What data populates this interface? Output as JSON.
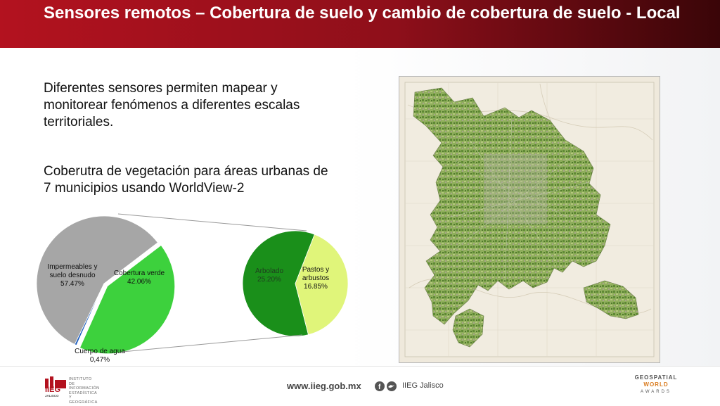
{
  "header": {
    "title": "Sensores remotos – Cobertura de suelo y cambio de cobertura de suelo - Local"
  },
  "body": {
    "paragraph1": "Diferentes sensores permiten mapear y monitorear fenómenos a diferentes escalas territoriales.",
    "paragraph2": "Coberutra de vegetación para áreas urbanas de 7 municipios usando WorldView-2"
  },
  "chart_data": [
    {
      "type": "pie",
      "categories": [
        "Impermeables y suelo desnudo",
        "Cobertura verde",
        "Cuerpo de agua"
      ],
      "values": [
        57.47,
        42.06,
        0.47
      ],
      "labels": [
        "Impermeables y suelo desnudo\n57.47%",
        "Cobertura verde\n42.06%",
        "Cuerpo de agua\n0,47%"
      ],
      "colors": [
        "#a6a6a6",
        "#3dd13d",
        "#1f5fbf"
      ]
    },
    {
      "type": "pie",
      "categories": [
        "Arbolado",
        "Pastos y arbustos"
      ],
      "values": [
        25.2,
        16.85
      ],
      "labels": [
        "Arbolado\n25.20%",
        "Pastos y\narbustos\n16.85%"
      ],
      "colors": [
        "#1a8f1a",
        "#e0f57a"
      ]
    }
  ],
  "footer": {
    "url": "www.iieg.gob.mx",
    "social_name": "IIEG Jalisco",
    "logo_short": "IIEG",
    "logo_sub": "JALISCO",
    "logo_text": "INSTITUTO DE INFORMACIÓN ESTADÍSTICA Y GEOGRÁFICA",
    "awards_line1": "GEOSPATIAL",
    "awards_line2": "WORLD",
    "awards_line3": "AWARDS"
  }
}
